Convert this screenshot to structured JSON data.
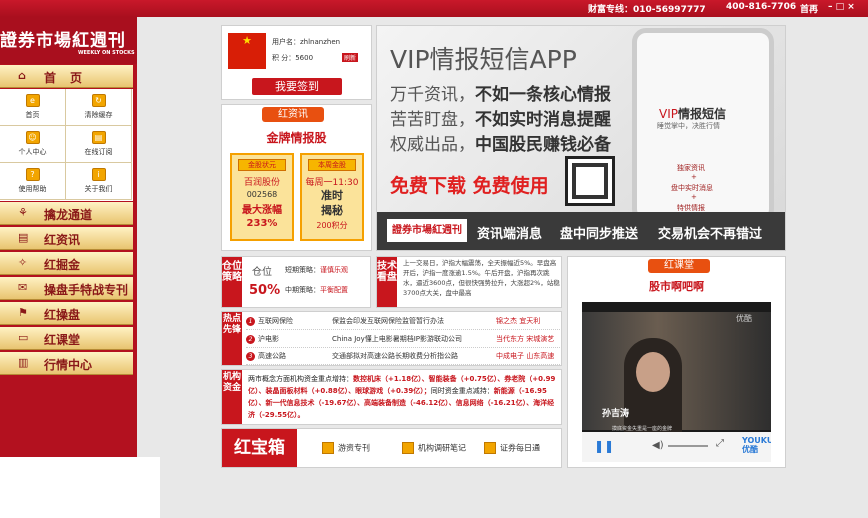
{
  "topbar": {
    "hotline_label": "财富专线：010-56997777",
    "phone2": "400-816-7706",
    "link": "首再",
    "controls": "– □ ×"
  },
  "logo": {
    "title": "證券市場紅週刊",
    "subtitle": "WEEKLY ON STOCKS"
  },
  "nav": {
    "home": "首页",
    "quick": [
      {
        "label": "首页",
        "icon": "e"
      },
      {
        "label": "清除缓存",
        "icon": "↻"
      },
      {
        "label": "个人中心",
        "icon": "☺"
      },
      {
        "label": "在线订阅",
        "icon": "▤"
      },
      {
        "label": "使用帮助",
        "icon": "?"
      },
      {
        "label": "关于我们",
        "icon": "i"
      }
    ],
    "items": [
      {
        "label": "擒龙通道",
        "icon": "⚘"
      },
      {
        "label": "红资讯",
        "icon": "▤"
      },
      {
        "label": "红掘金",
        "icon": "✧"
      },
      {
        "label": "操盘手特战专刊",
        "icon": "✉"
      },
      {
        "label": "红操盘",
        "icon": "⚑"
      },
      {
        "label": "红课堂",
        "icon": "▭"
      },
      {
        "label": "行情中心",
        "icon": "▥"
      }
    ]
  },
  "user": {
    "username_label": "用户名：zhlnanzhen",
    "points_label": "积  分：5600",
    "badge": "刷新",
    "signin": "我要签到",
    "flag_text": "★"
  },
  "banner": {
    "title": "VIP情报短信APP",
    "line1_a": "万千资讯，",
    "line1_b": "不如一条核心情报",
    "line2_a": "苦苦盯盘，",
    "line2_b": "不如实时消息提醒",
    "line3_a": "权威出品，",
    "line3_b": "中国股民赚钱必备",
    "download": "免费下载 免费使用",
    "phone_title_a": "VIP",
    "phone_title_b": "情报短信",
    "phone_slogan": "睡觉掌中，决胜行情",
    "phone_lines": [
      "独家资讯",
      "+",
      "盘中实时消息",
      "+",
      "特供情报"
    ],
    "strip_logo": "證券市場紅週刊",
    "strip_items": [
      "资讯端消息",
      "盘中同步推送",
      "交易机会不再错过"
    ]
  },
  "news": {
    "tab": "红资讯",
    "heading": "金牌情报股",
    "card1": {
      "tag": "金股状元",
      "name": "百润股份",
      "code": "002568",
      "l1": "最大涨幅",
      "l2": "233%"
    },
    "card2": {
      "tag": "本周金股",
      "time": "每周一11:30",
      "l1": "准时",
      "l2": "揭秘",
      "l3": "200积分"
    }
  },
  "position": {
    "label": "仓位策略",
    "title": "仓位",
    "value": "50%",
    "short_label": "短期策略：",
    "short_value": "谨慎乐观",
    "mid_label": "中期策略：",
    "mid_value": "平衡配置"
  },
  "tech": {
    "label": "技术看盘",
    "text": "上一交易日，沪指大幅震荡，全天振幅近5%。早盘高开后，沪指一度涨逾1.5%。午后开盘，沪指再次跳水，逼近3600点，但很快强势拉升，大涨超2%，站稳3700点大关，盘中最高"
  },
  "hot": {
    "label": "热点先锋",
    "rows": [
      {
        "num": "1",
        "topic": "互联网保险",
        "news": "保监会印发互联网保险监管暂行办法",
        "stocks": "锦之杰  宜天利"
      },
      {
        "num": "2",
        "topic": "沪电影",
        "news": "China Joy懂上电影暑期档IP影游联动公司",
        "stocks": "当代东方  宋城演艺"
      },
      {
        "num": "3",
        "topic": "高速公路",
        "news": "交通部拟对高速公路长期收费分析指公路",
        "stocks": "中成电子  山东高速"
      }
    ]
  },
  "institution": {
    "label": "机构资金",
    "intro": "两市概念方面机构资金重点增持：",
    "buy": "数控机床（+1.18亿）、智能装备（+0.75亿）、券老院（+0.99亿）、装晶面板材料（+0.88亿）、眼球游戏（+0.39亿）；",
    "mid": "同时资金重点减持：",
    "sell": "新能源（-16.95亿）、新一代信息技术（-19.67亿）、高端装备制造（-46.12亿）、信息网络（-16.21亿）、海洋经济（-29.55亿）。"
  },
  "treasure": {
    "title": "红宝箱",
    "items": [
      "游资专刊",
      "机构调研笔记",
      "证券每日通"
    ]
  },
  "classroom": {
    "tab": "红课堂",
    "heading": "股市啊吧啊",
    "video_brand": "优酷",
    "caption": "孙吉涛",
    "caption_sub": "摸底资金失重是一座的金牌",
    "player_logo": "YOUKU 优酷"
  }
}
